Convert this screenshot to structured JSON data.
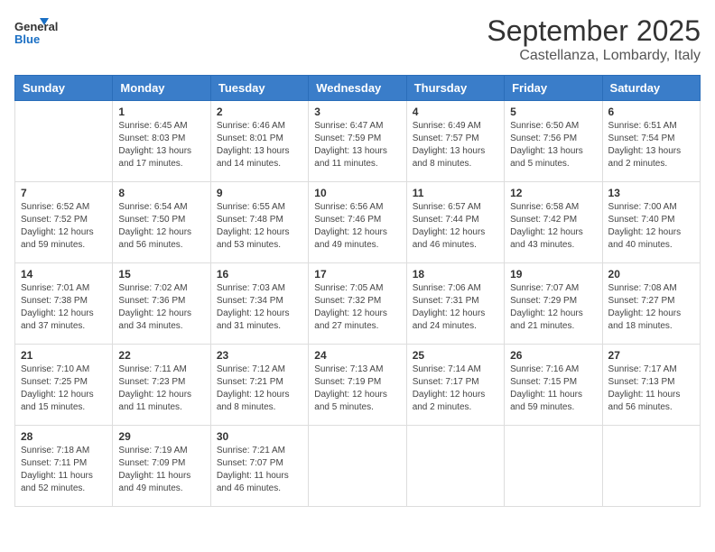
{
  "logo": {
    "text_general": "General",
    "text_blue": "Blue"
  },
  "header": {
    "month": "September 2025",
    "location": "Castellanza, Lombardy, Italy"
  },
  "weekdays": [
    "Sunday",
    "Monday",
    "Tuesday",
    "Wednesday",
    "Thursday",
    "Friday",
    "Saturday"
  ],
  "weeks": [
    [
      {
        "day": "",
        "info": ""
      },
      {
        "day": "1",
        "info": "Sunrise: 6:45 AM\nSunset: 8:03 PM\nDaylight: 13 hours\nand 17 minutes."
      },
      {
        "day": "2",
        "info": "Sunrise: 6:46 AM\nSunset: 8:01 PM\nDaylight: 13 hours\nand 14 minutes."
      },
      {
        "day": "3",
        "info": "Sunrise: 6:47 AM\nSunset: 7:59 PM\nDaylight: 13 hours\nand 11 minutes."
      },
      {
        "day": "4",
        "info": "Sunrise: 6:49 AM\nSunset: 7:57 PM\nDaylight: 13 hours\nand 8 minutes."
      },
      {
        "day": "5",
        "info": "Sunrise: 6:50 AM\nSunset: 7:56 PM\nDaylight: 13 hours\nand 5 minutes."
      },
      {
        "day": "6",
        "info": "Sunrise: 6:51 AM\nSunset: 7:54 PM\nDaylight: 13 hours\nand 2 minutes."
      }
    ],
    [
      {
        "day": "7",
        "info": "Sunrise: 6:52 AM\nSunset: 7:52 PM\nDaylight: 12 hours\nand 59 minutes."
      },
      {
        "day": "8",
        "info": "Sunrise: 6:54 AM\nSunset: 7:50 PM\nDaylight: 12 hours\nand 56 minutes."
      },
      {
        "day": "9",
        "info": "Sunrise: 6:55 AM\nSunset: 7:48 PM\nDaylight: 12 hours\nand 53 minutes."
      },
      {
        "day": "10",
        "info": "Sunrise: 6:56 AM\nSunset: 7:46 PM\nDaylight: 12 hours\nand 49 minutes."
      },
      {
        "day": "11",
        "info": "Sunrise: 6:57 AM\nSunset: 7:44 PM\nDaylight: 12 hours\nand 46 minutes."
      },
      {
        "day": "12",
        "info": "Sunrise: 6:58 AM\nSunset: 7:42 PM\nDaylight: 12 hours\nand 43 minutes."
      },
      {
        "day": "13",
        "info": "Sunrise: 7:00 AM\nSunset: 7:40 PM\nDaylight: 12 hours\nand 40 minutes."
      }
    ],
    [
      {
        "day": "14",
        "info": "Sunrise: 7:01 AM\nSunset: 7:38 PM\nDaylight: 12 hours\nand 37 minutes."
      },
      {
        "day": "15",
        "info": "Sunrise: 7:02 AM\nSunset: 7:36 PM\nDaylight: 12 hours\nand 34 minutes."
      },
      {
        "day": "16",
        "info": "Sunrise: 7:03 AM\nSunset: 7:34 PM\nDaylight: 12 hours\nand 31 minutes."
      },
      {
        "day": "17",
        "info": "Sunrise: 7:05 AM\nSunset: 7:32 PM\nDaylight: 12 hours\nand 27 minutes."
      },
      {
        "day": "18",
        "info": "Sunrise: 7:06 AM\nSunset: 7:31 PM\nDaylight: 12 hours\nand 24 minutes."
      },
      {
        "day": "19",
        "info": "Sunrise: 7:07 AM\nSunset: 7:29 PM\nDaylight: 12 hours\nand 21 minutes."
      },
      {
        "day": "20",
        "info": "Sunrise: 7:08 AM\nSunset: 7:27 PM\nDaylight: 12 hours\nand 18 minutes."
      }
    ],
    [
      {
        "day": "21",
        "info": "Sunrise: 7:10 AM\nSunset: 7:25 PM\nDaylight: 12 hours\nand 15 minutes."
      },
      {
        "day": "22",
        "info": "Sunrise: 7:11 AM\nSunset: 7:23 PM\nDaylight: 12 hours\nand 11 minutes."
      },
      {
        "day": "23",
        "info": "Sunrise: 7:12 AM\nSunset: 7:21 PM\nDaylight: 12 hours\nand 8 minutes."
      },
      {
        "day": "24",
        "info": "Sunrise: 7:13 AM\nSunset: 7:19 PM\nDaylight: 12 hours\nand 5 minutes."
      },
      {
        "day": "25",
        "info": "Sunrise: 7:14 AM\nSunset: 7:17 PM\nDaylight: 12 hours\nand 2 minutes."
      },
      {
        "day": "26",
        "info": "Sunrise: 7:16 AM\nSunset: 7:15 PM\nDaylight: 11 hours\nand 59 minutes."
      },
      {
        "day": "27",
        "info": "Sunrise: 7:17 AM\nSunset: 7:13 PM\nDaylight: 11 hours\nand 56 minutes."
      }
    ],
    [
      {
        "day": "28",
        "info": "Sunrise: 7:18 AM\nSunset: 7:11 PM\nDaylight: 11 hours\nand 52 minutes."
      },
      {
        "day": "29",
        "info": "Sunrise: 7:19 AM\nSunset: 7:09 PM\nDaylight: 11 hours\nand 49 minutes."
      },
      {
        "day": "30",
        "info": "Sunrise: 7:21 AM\nSunset: 7:07 PM\nDaylight: 11 hours\nand 46 minutes."
      },
      {
        "day": "",
        "info": ""
      },
      {
        "day": "",
        "info": ""
      },
      {
        "day": "",
        "info": ""
      },
      {
        "day": "",
        "info": ""
      }
    ]
  ]
}
